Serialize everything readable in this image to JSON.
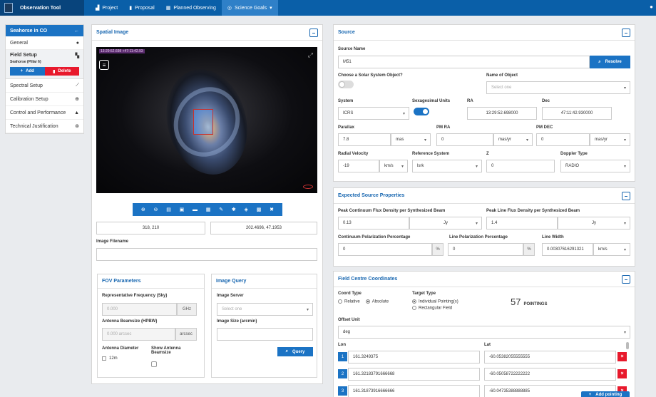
{
  "topbar": {
    "app": "Observation Tool",
    "nav": [
      "Project",
      "Proposal",
      "Planned Observing",
      "Science Goals"
    ]
  },
  "sidebar": {
    "header": "Seahorse in CO",
    "items": [
      "General",
      "Field Setup",
      "Spectral Setup",
      "Calibration Setup",
      "Control and Performance",
      "Technical Justification"
    ],
    "field_sub": "Seahorse (Pillar 6)",
    "add": "Add",
    "delete": "Delete"
  },
  "spatial": {
    "title": "Spatial Image",
    "sky_label": "13:29:52.698 +47:11:42.93",
    "pixel": "318, 210",
    "coords": "202.4696, 47.1953",
    "filename_label": "Image Filename",
    "filename": ""
  },
  "fov": {
    "title": "FOV Parameters",
    "rep_freq_label": "Representative Frequency (Sky)",
    "rep_freq_ph": "0.000",
    "rep_freq_unit": "GHz",
    "beam_label": "Antenna Beamsize (HPBW)",
    "beam_ph": "0.000 arcsec",
    "beam_unit": "arcsec",
    "diam_label": "Antenna Diameter",
    "diam_value": "12m",
    "show_beam_label": "Show Antenna Beamsize"
  },
  "query": {
    "title": "Image Query",
    "server_label": "Image Server",
    "server_ph": "Select one",
    "size_label": "Image Size (arcmin)",
    "size": "",
    "button": "Query"
  },
  "source": {
    "title": "Source",
    "name_label": "Source Name",
    "name": "M51",
    "resolve": "Resolve",
    "solar_label": "Choose a Solar System Object?",
    "object_label": "Name of Object",
    "object_ph": "Select one",
    "system_label": "System",
    "system": "ICRS",
    "sexa_label": "Sexagesimal Units",
    "ra_label": "RA",
    "ra": "13:29:52.698000",
    "dec_label": "Dec",
    "dec": "47:11:42.930000",
    "parallax_label": "Parallax",
    "parallax": "7.8",
    "parallax_unit": "mas",
    "pmra_label": "PM RA",
    "pmra": "0",
    "pmra_unit": "mas/yr",
    "pmdec_label": "PM DEC",
    "pmdec": "0",
    "pmdec_unit": "mas/yr",
    "rv_label": "Radial Velocity",
    "rv": "-19",
    "rv_unit": "km/s",
    "ref_label": "Reference System",
    "ref": "lsrk",
    "z_label": "Z",
    "z": "0",
    "doppler_label": "Doppler Type",
    "doppler": "RADIO"
  },
  "expected": {
    "title": "Expected Source Properties",
    "peak_cont_label": "Peak Continuum Flux Density per Synthesized Beam",
    "peak_cont": "0.13",
    "peak_cont_unit": "Jy",
    "peak_line_label": "Peak Line Flux Density per Synthesized Beam",
    "peak_line": "1.4",
    "peak_line_unit": "Jy",
    "cont_pol_label": "Continuum Polarization Percentage",
    "cont_pol": "0",
    "pct": "%",
    "line_pol_label": "Line Polarization Percentage",
    "line_pol": "0",
    "line_width_label": "Line Width",
    "line_width": "0.00307616291321",
    "line_width_unit": "km/s"
  },
  "field": {
    "title": "Field Centre Coordinates",
    "coord_type_label": "Coord Type",
    "relative": "Relative",
    "absolute": "Absolute",
    "target_type_label": "Target Type",
    "individual": "Individual Pointing(s)",
    "rectangular": "Rectangular Field",
    "pointings_count": "57",
    "pointings_label": "POINTINGS",
    "offset_label": "Offset Unit",
    "offset": "deg",
    "lon_label": "Lon",
    "lat_label": "Lat",
    "rows": [
      {
        "n": "1",
        "lon": "161.3249375",
        "lat": "-60.05382055555555"
      },
      {
        "n": "2",
        "lon": "161.32183791666668",
        "lat": "-60.05058722222222"
      },
      {
        "n": "3",
        "lon": "161.31873916666666",
        "lat": "-60.04735388888885"
      }
    ],
    "add_pointing": "Add pointing"
  }
}
